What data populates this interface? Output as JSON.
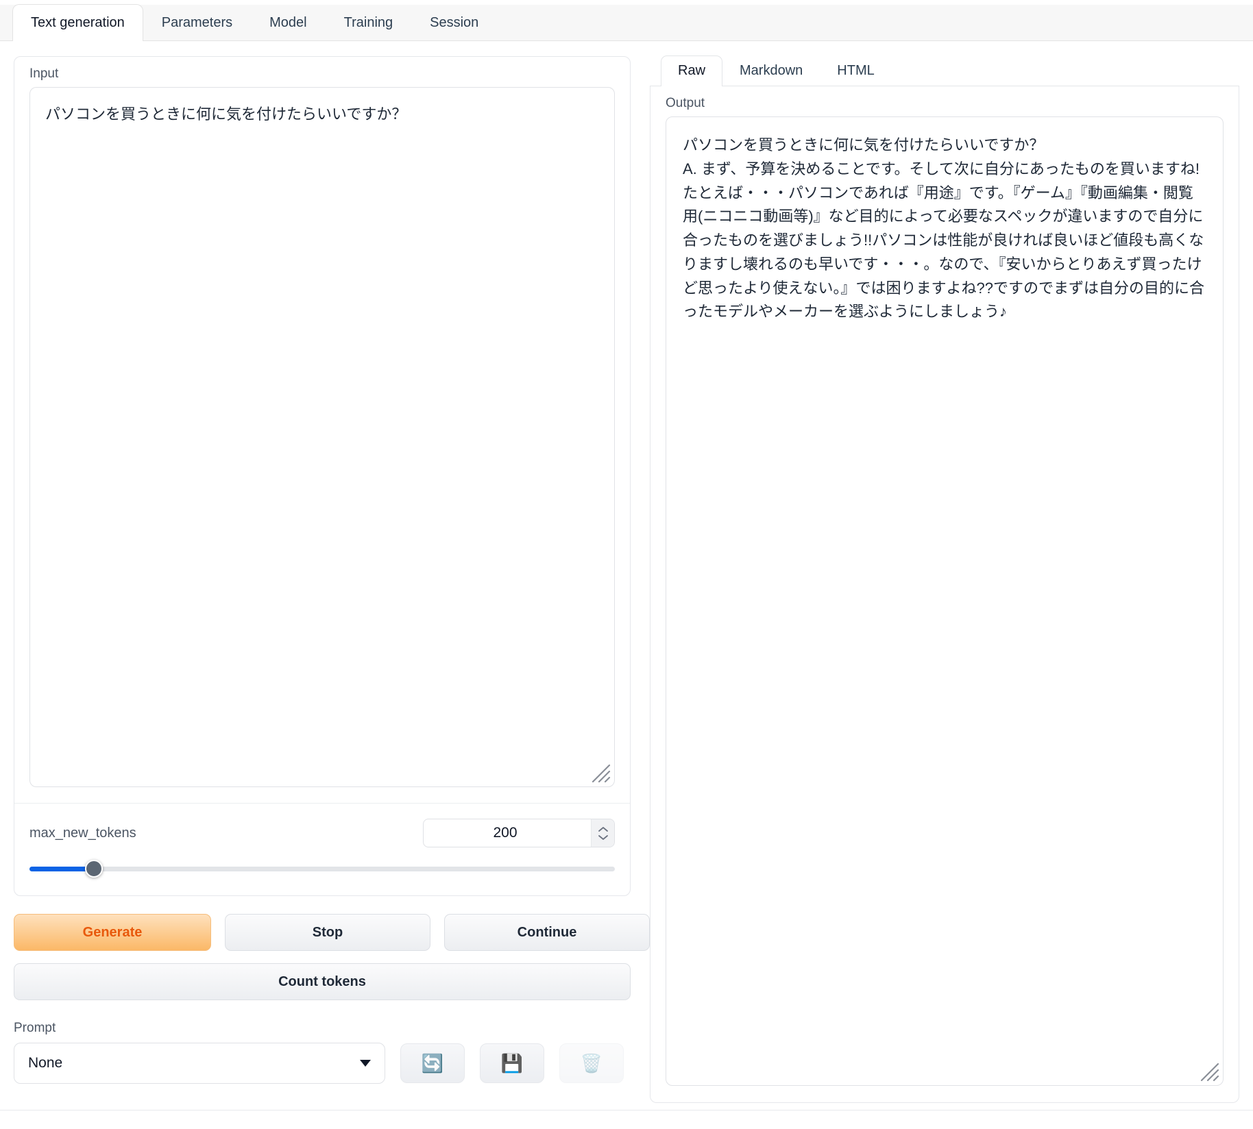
{
  "topbar": {
    "tabs": [
      {
        "label": "Text generation",
        "active": true
      },
      {
        "label": "Parameters",
        "active": false
      },
      {
        "label": "Model",
        "active": false
      },
      {
        "label": "Training",
        "active": false
      },
      {
        "label": "Session",
        "active": false
      }
    ]
  },
  "left": {
    "input_label": "Input",
    "input_value": "パソコンを買うときに何に気を付けたらいいですか？",
    "slider": {
      "name": "max_new_tokens",
      "value": "200",
      "fill_percent": 11
    },
    "buttons": {
      "generate": "Generate",
      "stop": "Stop",
      "continue": "Continue",
      "count_tokens": "Count tokens"
    },
    "prompt": {
      "label": "Prompt",
      "selected": "None",
      "refresh_icon": "🔄",
      "save_icon": "💾",
      "delete_icon": "🗑️"
    }
  },
  "right": {
    "tabs": [
      {
        "label": "Raw",
        "active": true
      },
      {
        "label": "Markdown",
        "active": false
      },
      {
        "label": "HTML",
        "active": false
      }
    ],
    "output_label": "Output",
    "output_text": "パソコンを買うときに何に気を付けたらいいですか？\nA. まず、予算を決めることです。そして次に自分にあったものを買いますね!たとえば・・・パソコンであれば『用途』です。『ゲーム』『動画編集・閲覧用(ニコニコ動画等)』など目的によって必要なスペックが違いますので自分に合ったものを選びましょう!!パソコンは性能が良ければ良いほど値段も高くなりますし壊れるのも早いです・・・。なので、『安いからとりあえず買ったけど思ったより使えない。』では困りますよね??ですのでまずは自分の目的に合ったモデルやメーカーを選ぶようにしましょう♪"
  },
  "colors": {
    "accent_orange": "#e8590c",
    "slider_blue": "#0b63e5",
    "text_primary": "#1f2937",
    "label_gray": "#4b5563",
    "border": "#e5e7eb"
  }
}
